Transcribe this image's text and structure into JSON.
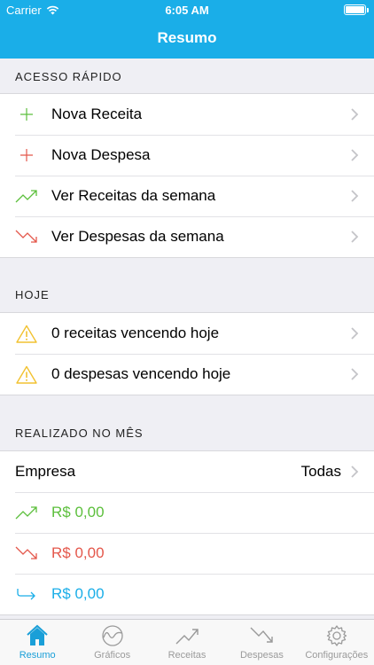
{
  "status_bar": {
    "carrier": "Carrier",
    "time": "6:05 AM"
  },
  "nav": {
    "title": "Resumo"
  },
  "quick_access": {
    "header": "ACESSO RÁPIDO",
    "items": [
      {
        "label": "Nova Receita",
        "icon": "plus-green-icon"
      },
      {
        "label": "Nova Despesa",
        "icon": "plus-red-icon"
      },
      {
        "label": "Ver Receitas da semana",
        "icon": "trend-up-icon"
      },
      {
        "label": "Ver Despesas da semana",
        "icon": "trend-down-icon"
      }
    ]
  },
  "today": {
    "header": "HOJE",
    "items": [
      {
        "label": "0 receitas vencendo hoje",
        "icon": "warning-icon"
      },
      {
        "label": "0 despesas vencendo hoje",
        "icon": "warning-icon"
      }
    ]
  },
  "month": {
    "header": "REALIZADO NO MÊS",
    "company_label": "Empresa",
    "company_value": "Todas",
    "income": "R$ 0,00",
    "expense": "R$ 0,00",
    "balance": "R$ 0,00"
  },
  "tabs": [
    {
      "label": "Resumo",
      "icon": "home-icon",
      "active": true
    },
    {
      "label": "Gráficos",
      "icon": "chart-icon",
      "active": false
    },
    {
      "label": "Receitas",
      "icon": "trend-up-icon",
      "active": false
    },
    {
      "label": "Despesas",
      "icon": "trend-down-icon",
      "active": false
    },
    {
      "label": "Configurações",
      "icon": "gear-icon",
      "active": false
    }
  ],
  "colors": {
    "brand": "#1aaee8",
    "income": "#5cbf3c",
    "expense": "#e4574b",
    "balance": "#1aaee8",
    "warning": "#f2c230"
  }
}
